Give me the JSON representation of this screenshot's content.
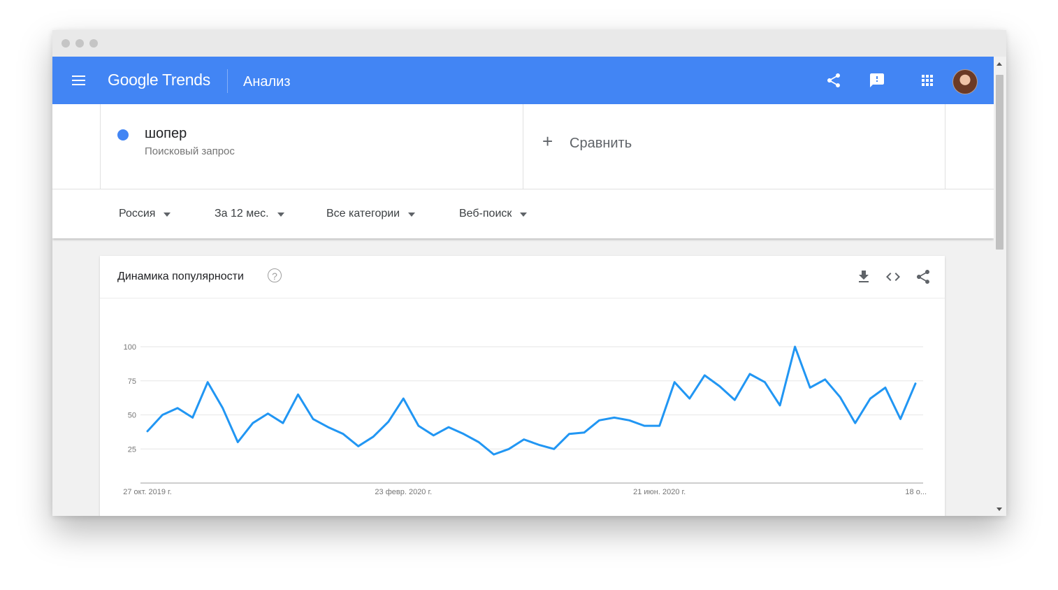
{
  "window": {
    "controls": [
      "close",
      "minimize",
      "maximize"
    ]
  },
  "appbar": {
    "logo": "Google Trends",
    "page_title": "Анализ",
    "icons": [
      "menu-icon",
      "share-icon",
      "feedback-icon",
      "apps-icon",
      "account-avatar"
    ],
    "background": "#4285f4"
  },
  "terms": [
    {
      "name": "шопер",
      "type": "Поисковый запрос",
      "color": "#4285f4"
    }
  ],
  "compare": {
    "icon": "+",
    "label": "Сравнить"
  },
  "filters": [
    {
      "label": "Россия"
    },
    {
      "label": "За 12 мес."
    },
    {
      "label": "Все категории"
    },
    {
      "label": "Веб-поиск"
    }
  ],
  "card": {
    "title": "Динамика популярности",
    "help_icon": "?",
    "actions": [
      "download-icon",
      "embed-icon",
      "share-icon"
    ]
  },
  "chart_data": {
    "type": "line",
    "title": "",
    "xlabel": "",
    "ylabel": "",
    "ylim": [
      0,
      100
    ],
    "y_ticks": [
      25,
      50,
      75,
      100
    ],
    "x_tick_labels": [
      "27 окт. 2019 г.",
      "23 февр. 2020 г.",
      "21 июн. 2020 г.",
      "18 о..."
    ],
    "x_tick_indices": [
      0,
      17,
      34,
      51.5
    ],
    "grid": true,
    "series": [
      {
        "color": "#2196f3",
        "values": [
          38,
          50,
          55,
          48,
          74,
          55,
          30,
          44,
          51,
          44,
          65,
          47,
          41,
          36,
          27,
          34,
          45,
          62,
          42,
          35,
          41,
          36,
          30,
          21,
          25,
          32,
          28,
          25,
          36,
          37,
          46,
          48,
          46,
          42,
          42,
          74,
          62,
          79,
          71,
          61,
          80,
          74,
          57,
          100,
          70,
          76,
          63,
          44,
          62,
          70,
          47,
          73
        ]
      }
    ]
  }
}
